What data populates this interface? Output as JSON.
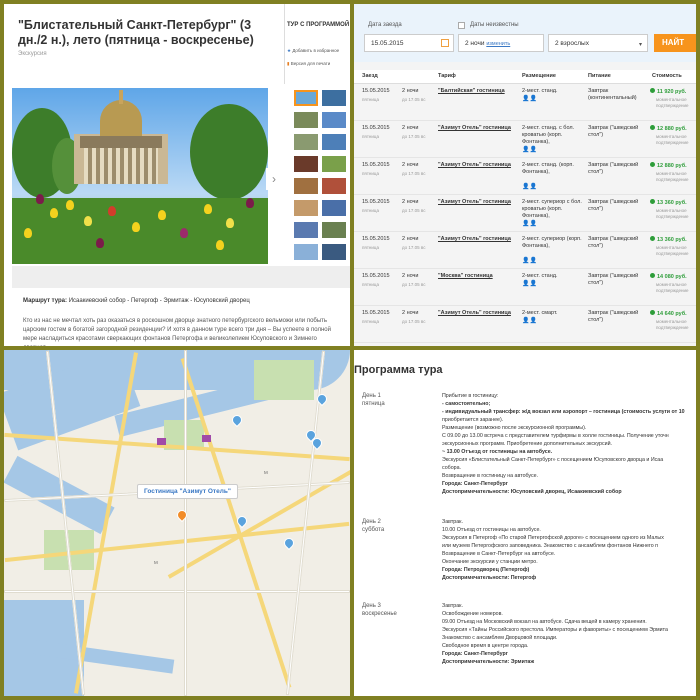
{
  "tour": {
    "title": "\"Блистательный Санкт-Петербург\" (3 дн./2 н.), лето (пятница - воскресенье)",
    "subtitle": "Экскурсия",
    "sidebar_heading": "ТУР С ПРОГРАММОЙ",
    "sidebar_links": [
      "Добавить в избранное",
      "Версия для печати"
    ],
    "route_label": "Маршрут тура:",
    "route": "Исаакиевский собор - Петергоф - Эрмитаж - Юсуповский дворец",
    "description": "Кто из нас не мечтал хоть раз оказаться в роскошном дворце знатного петербургского вельможи или побыть царским гостем в богатой загородной резиденции? И хотя в данном туре всего три дня – Вы успеете в полной мере насладиться красотами сверкающих фонтанов Петергофа и великолепием Юсуповского и Зимнего дворцов…",
    "next_arrow": "›"
  },
  "search": {
    "date_label": "Дата заезда",
    "date_value": "15.05.2015",
    "unknown_dates_label": "Даты неизвестны",
    "nights_value": "2 ночи",
    "change_link": "изменить",
    "guests_value": "2 взрослых",
    "find_button": "НАЙТ",
    "dropdown_arrow": "▾"
  },
  "table": {
    "headers": [
      "Заезд",
      "Тариф",
      "Размещение",
      "Питание",
      "Стоимость"
    ],
    "rows": [
      {
        "date": "15.05.2015",
        "weekday": "пятница",
        "nights": "2 ночи",
        "until": "до 17.05 вс",
        "hotel": "\"Балтийская\" гостиница",
        "room": "2-мест. станд.",
        "meal": "Завтрак (континентальный)",
        "price": "11 920 руб.",
        "note": "моментальное подтверждение"
      },
      {
        "date": "15.05.2015",
        "weekday": "пятница",
        "nights": "2 ночи",
        "until": "до 17.05 вс",
        "hotel": "\"Азимут Отель\" гостиница",
        "room": "2-мест. станд. с бол. кроватью (корп. Фонтанка),",
        "meal": "Завтрак (\"шведский стол\")",
        "price": "12 880 руб.",
        "note": "моментальное подтверждение"
      },
      {
        "date": "15.05.2015",
        "weekday": "пятница",
        "nights": "2 ночи",
        "until": "до 17.05 вс",
        "hotel": "\"Азимут Отель\" гостиница",
        "room": "2-мест. станд. (корп. Фонтанка),",
        "meal": "Завтрак (\"шведский стол\")",
        "price": "12 880 руб.",
        "note": "моментальное подтверждение"
      },
      {
        "date": "15.05.2015",
        "weekday": "пятница",
        "nights": "2 ночи",
        "until": "до 17.05 вс",
        "hotel": "\"Азимут Отель\" гостиница",
        "room": "2-мест. супериор с бол. кроватью (корп. Фонтанка),",
        "meal": "Завтрак (\"шведский стол\")",
        "price": "13 360 руб.",
        "note": "моментальное подтверждение"
      },
      {
        "date": "15.05.2015",
        "weekday": "пятница",
        "nights": "2 ночи",
        "until": "до 17.05 вс",
        "hotel": "\"Азимут Отель\" гостиница",
        "room": "2-мест. супериор (корп. Фонтанка),",
        "meal": "Завтрак (\"шведский стол\")",
        "price": "13 360 руб.",
        "note": "моментальное подтверждение"
      },
      {
        "date": "15.05.2015",
        "weekday": "пятница",
        "nights": "2 ночи",
        "until": "до 17.05 вс",
        "hotel": "\"Москва\" гостиница",
        "room": "2-мест. станд.",
        "meal": "Завтрак (\"шведский стол\")",
        "price": "14 080 руб.",
        "note": "моментальное подтверждение"
      },
      {
        "date": "15.05.2015",
        "weekday": "пятница",
        "nights": "2 ночи",
        "until": "до 17.05 вс",
        "hotel": "\"Азимут Отель\" гостиница",
        "room": "2-мест. смарт.",
        "meal": "Завтрак (\"шведский стол\")",
        "price": "14 640 руб.",
        "note": "моментальное подтверждение"
      }
    ]
  },
  "map": {
    "tooltip": "Гостиница \"Азимут Отель\"",
    "metro_label": "М"
  },
  "program": {
    "heading": "Программа тура",
    "days": [
      {
        "label": "День 1",
        "weekday": "пятница",
        "lines": [
          "Прибытие в гостиницу:",
          "- самостоятельно;",
          "- индивидуальный трансфер: ж/д вокзал или аэропорт – гостиница (стоимость услуги от 10",
          "приобретается заранее).",
          "Размещение (возможно после экскурсионной программы).",
          "С 09.00 до 13.00 встреча с представителем турфирмы в холле гостиницы. Получение уточн",
          "экскурсионных программ. Приобретение дополнительных экскурсий.",
          "~ 13.00 Отъезд от гостиницы на автобусе.",
          "Экскурсия «Блистательный Санкт-Петербург» с посещением Юсуповского дворца и Исаа",
          "собора.",
          "Возвращение в гостиницу на автобусе.",
          "Города: Санкт-Петербург",
          "Достопримечательности: Юсуповский дворец, Исаакиевский собор"
        ]
      },
      {
        "label": "День 2",
        "weekday": "суббота",
        "lines": [
          "Завтрак.",
          "10.00 Отъезд от гостиницы на автобусе.",
          "Экскурсия в Петергоф «По старой Петергофской дороге» с посещением одного из Малых",
          "или музеев Петергофского заповедника. Знакомство с ансамблем фонтанов Нижнего п",
          "Возвращение в Санкт-Петербург на автобусе.",
          "Окончание экскурсии у станции метро.",
          "Города: Петродворец (Петергоф)",
          "Достопримечательности: Петергоф"
        ]
      },
      {
        "label": "День 3",
        "weekday": "воскресенье",
        "lines": [
          "Завтрак.",
          "Освобождение номеров.",
          "09.00 Отъезд на Московский вокзал на автобусе. Сдача вещей в камеру хранения.",
          "Экскурсия «Тайны Российского престола. Императоры и фавориты» с посещением Эрмита",
          "Знакомство с ансамблем Дворцовой площади.",
          "Свободное время в центре города.",
          "Города: Санкт-Петербург",
          "Достопримечательности: Эрмитаж"
        ]
      }
    ]
  },
  "colors": {
    "frame": "#808022",
    "accent": "#3a78c4",
    "price": "#2e9d3a",
    "button": "#f7941d",
    "hotel_pin": "#f28c28"
  }
}
